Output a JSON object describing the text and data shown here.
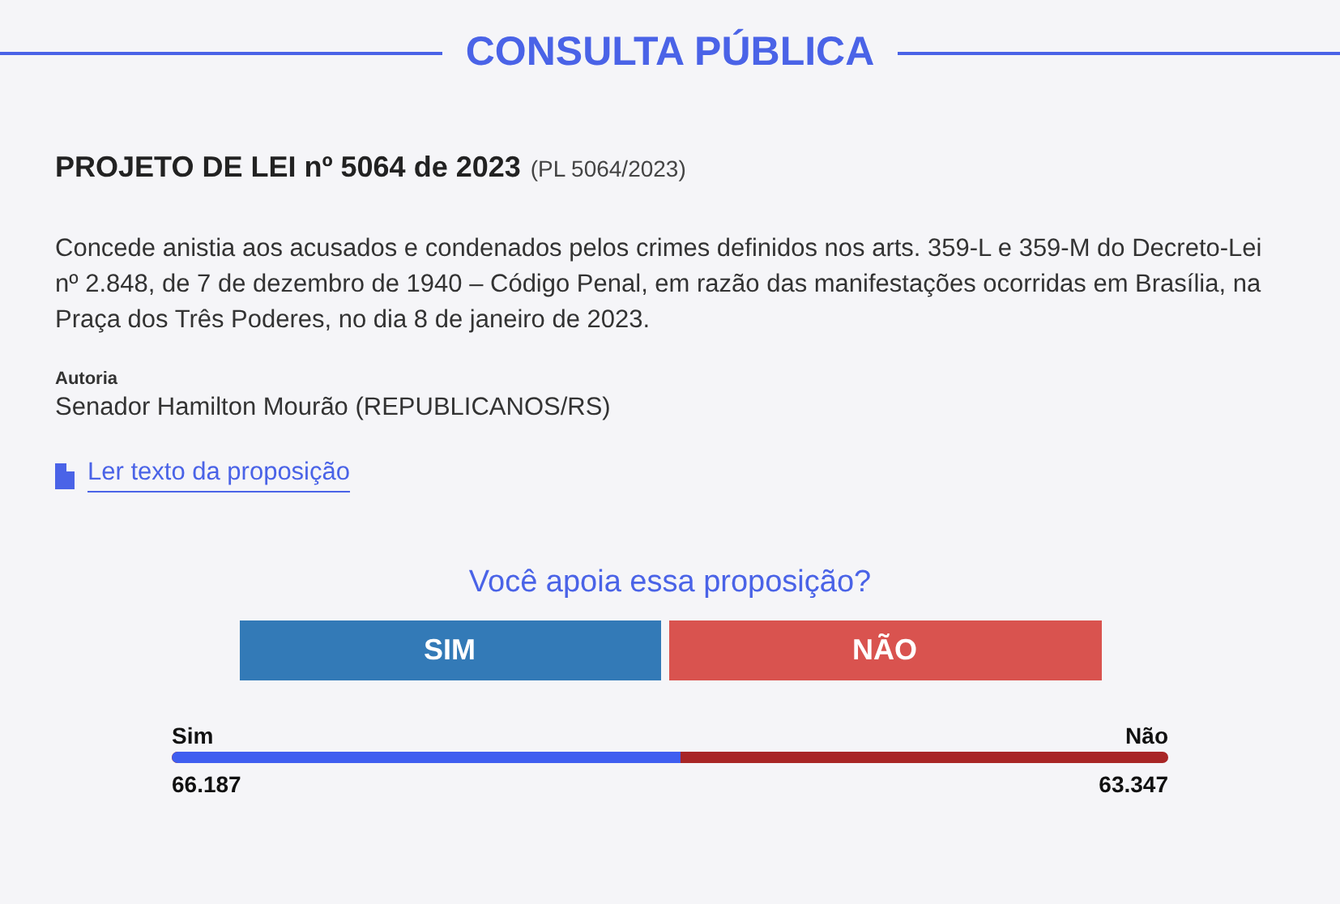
{
  "header": {
    "title": "CONSULTA PÚBLICA"
  },
  "bill": {
    "title": "PROJETO DE LEI nº 5064 de 2023",
    "code": "(PL 5064/2023)",
    "summary": "Concede anistia aos acusados e condenados pelos crimes definidos nos arts. 359-L e 359-M do Decreto-Lei nº 2.848, de 7 de dezembro de 1940 – Código Penal, em razão das manifestações ocorridas em Brasília, na Praça dos Três Poderes, no dia 8 de janeiro de 2023.",
    "authorship_label": "Autoria",
    "author": "Senador Hamilton Mourão (REPUBLICANOS/RS)",
    "link": "Ler texto da proposição"
  },
  "poll": {
    "question": "Você apoia essa proposição?",
    "buttons": [
      {
        "label": "SIM",
        "kind": "yes"
      },
      {
        "label": "NÃO",
        "kind": "no"
      }
    ],
    "result": {
      "yes_label": "Sim",
      "no_label": "Não",
      "level": 0.511,
      "yes_count": "66.187",
      "no_count": "63.347"
    }
  }
}
